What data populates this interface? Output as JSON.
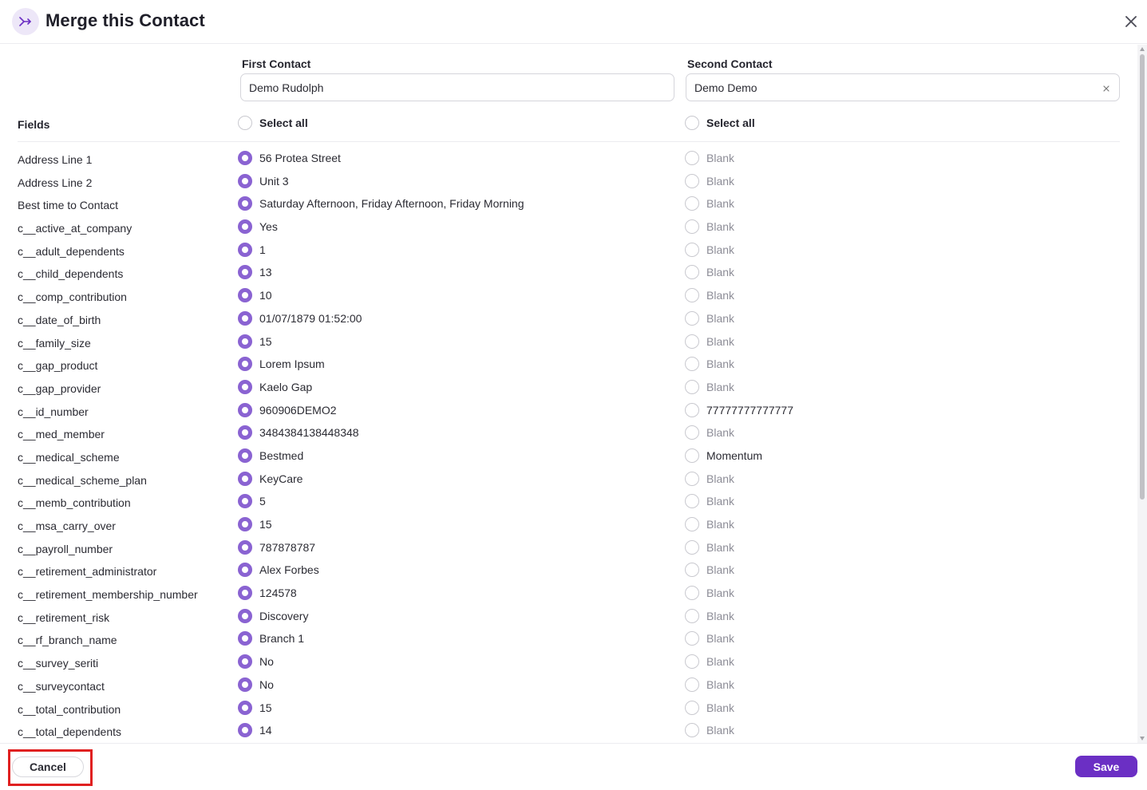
{
  "dialog": {
    "title": "Merge this Contact",
    "merge_icon": "merge-arrow-icon",
    "close_icon": "close-icon"
  },
  "first_contact": {
    "label": "First Contact",
    "value": "Demo Rudolph"
  },
  "second_contact": {
    "label": "Second Contact",
    "value": "Demo Demo"
  },
  "table": {
    "fields_header": "Fields",
    "select_all_first": "Select all",
    "select_all_second": "Select all",
    "rows": [
      {
        "field": "Address Line 1",
        "first": "56 Protea Street",
        "second": "Blank"
      },
      {
        "field": "Address Line 2",
        "first": "Unit 3",
        "second": "Blank"
      },
      {
        "field": "Best time to Contact",
        "first": "Saturday Afternoon, Friday Afternoon, Friday Morning",
        "second": "Blank"
      },
      {
        "field": "c__active_at_company",
        "first": "Yes",
        "second": "Blank"
      },
      {
        "field": "c__adult_dependents",
        "first": "1",
        "second": "Blank"
      },
      {
        "field": "c__child_dependents",
        "first": "13",
        "second": "Blank"
      },
      {
        "field": "c__comp_contribution",
        "first": "10",
        "second": "Blank"
      },
      {
        "field": "c__date_of_birth",
        "first": "01/07/1879 01:52:00",
        "second": "Blank"
      },
      {
        "field": "c__family_size",
        "first": "15",
        "second": "Blank"
      },
      {
        "field": "c__gap_product",
        "first": "Lorem Ipsum",
        "second": "Blank"
      },
      {
        "field": "c__gap_provider",
        "first": "Kaelo Gap",
        "second": "Blank"
      },
      {
        "field": "c__id_number",
        "first": "960906DEMO2",
        "second": "77777777777777"
      },
      {
        "field": "c__med_member",
        "first": "3484384138448348",
        "second": "Blank"
      },
      {
        "field": "c__medical_scheme",
        "first": "Bestmed",
        "second": "Momentum"
      },
      {
        "field": "c__medical_scheme_plan",
        "first": "KeyCare",
        "second": "Blank"
      },
      {
        "field": "c__memb_contribution",
        "first": "5",
        "second": "Blank"
      },
      {
        "field": "c__msa_carry_over",
        "first": "15",
        "second": "Blank"
      },
      {
        "field": "c__payroll_number",
        "first": "787878787",
        "second": "Blank"
      },
      {
        "field": "c__retirement_administrator",
        "first": "Alex Forbes",
        "second": "Blank"
      },
      {
        "field": "c__retirement_membership_number",
        "first": "124578",
        "second": "Blank"
      },
      {
        "field": "c__retirement_risk",
        "first": "Discovery",
        "second": "Blank"
      },
      {
        "field": "c__rf_branch_name",
        "first": "Branch 1",
        "second": "Blank"
      },
      {
        "field": "c__survey_seriti",
        "first": "No",
        "second": "Blank"
      },
      {
        "field": "c__surveycontact",
        "first": "No",
        "second": "Blank"
      },
      {
        "field": "c__total_contribution",
        "first": "15",
        "second": "Blank"
      },
      {
        "field": "c__total_dependents",
        "first": "14",
        "second": "Blank"
      }
    ]
  },
  "footer": {
    "cancel_label": "Cancel",
    "save_label": "Save"
  },
  "colors": {
    "accent": "#6b2fc4",
    "radio_selected": "#8a63d2",
    "highlight_outline": "#e02020",
    "blank_text": "#8d8d97"
  }
}
